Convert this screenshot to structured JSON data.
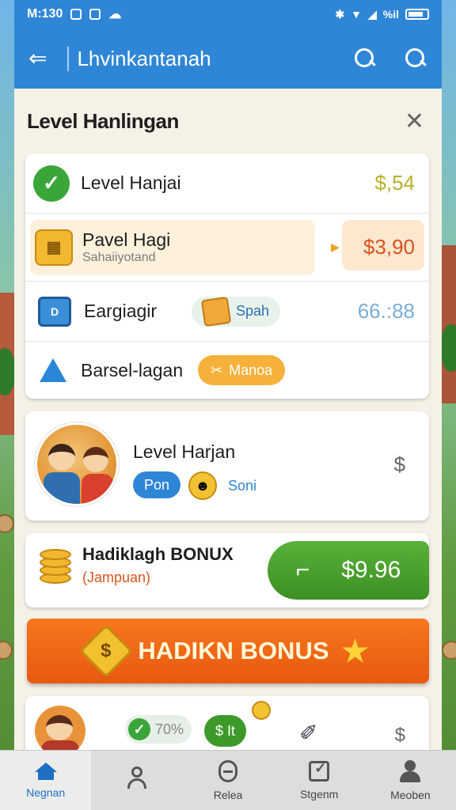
{
  "status": {
    "time": "M:130",
    "right": "%il"
  },
  "appbar": {
    "title": "Lhvinkantanah"
  },
  "panel": {
    "title": "Level Hanlingan"
  },
  "list": [
    {
      "label": "Level Hanjai",
      "value": "$,54",
      "value_color": "#b9b02a"
    },
    {
      "label": "Pavel Hagi",
      "sub": "Sahaiiyotand",
      "value": "$3,90",
      "value_color": "#d9531e"
    },
    {
      "label": "Eargiagir",
      "pill": "Spah",
      "value": "66.:88",
      "value_color": "#7aaed8"
    },
    {
      "label": "Barsel-lagan",
      "pill": "Manoa"
    }
  ],
  "level_card": {
    "title": "Level Harjan",
    "chip1": "Pon",
    "chip2": "Soni",
    "value": "$"
  },
  "bonus_card": {
    "title": "Hadiklagh BONUX",
    "sub": "(Jampuan)",
    "button_value": "$9.96",
    "button_glyph": "⌐"
  },
  "big_button": {
    "label": "HADIKN BONUS",
    "icon": "$"
  },
  "bottom_row": {
    "chip1": "70%",
    "chip2": "$ It",
    "value": "$"
  },
  "nav": [
    {
      "label": "Negnan",
      "icon": "home-icon"
    },
    {
      "label": "",
      "icon": "person-icon"
    },
    {
      "label": "Relea",
      "icon": "ring-icon"
    },
    {
      "label": "Stgenm",
      "icon": "check-icon"
    },
    {
      "label": "Meoben",
      "icon": "pawn-icon"
    }
  ],
  "colors": {
    "primary": "#2f86d6",
    "green": "#3d8f22",
    "orange": "#e75910"
  }
}
